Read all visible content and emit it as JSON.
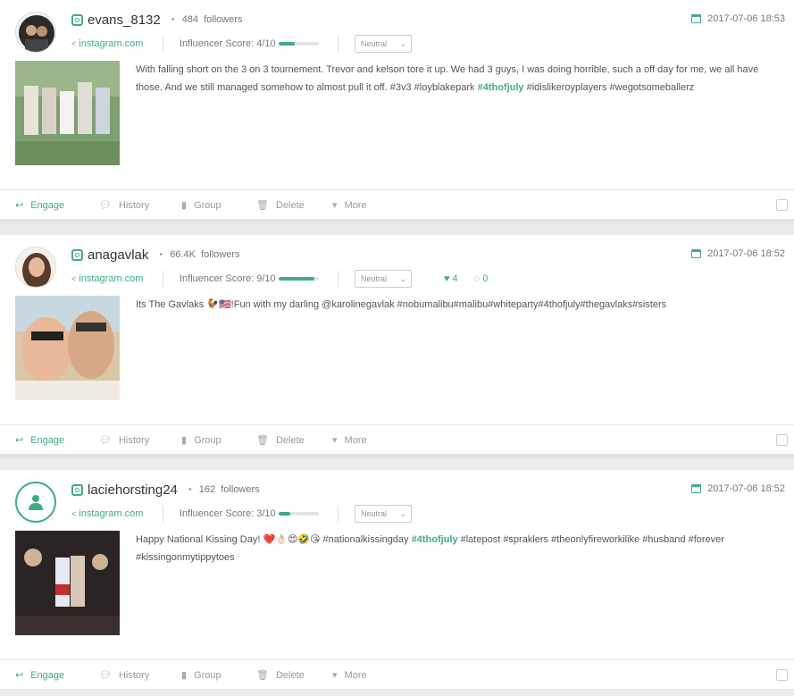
{
  "accent_color": "#3fad83",
  "action_labels": {
    "engage": "Engage",
    "history": "History",
    "group": "Group",
    "delete": "Delete",
    "more": "More"
  },
  "posts": [
    {
      "username": "evans_8132",
      "followers": "484",
      "followers_label": "followers",
      "source": "instagram.com",
      "influencer_label": "Influencer Score:",
      "influencer_score": "4/10",
      "influencer_value": 0.4,
      "sentiment": "Neutral",
      "date": "2017-07-06 18:53",
      "likes": null,
      "comments": null,
      "caption_parts": [
        {
          "text": "With falling short on the 3 on 3 tournement. Trevor and kelson tore it up. We had 3 guys, I was doing horrible, such a off day for me, we all have those. And we still managed somehow to almost pull it off. #3v3 #loyblakepark ",
          "tag": false
        },
        {
          "text": "#4thofjuly",
          "tag": true
        },
        {
          "text": " #idislikeroyplayers #wegotsomeballerz",
          "tag": false
        }
      ],
      "avatar_type": "photo",
      "photo_icon": "group-photo"
    },
    {
      "username": "anagavlak",
      "followers": "66.4K",
      "followers_label": "followers",
      "source": "instagram.com",
      "influencer_label": "Influencer Score:",
      "influencer_score": "9/10",
      "influencer_value": 0.9,
      "sentiment": "Neutral",
      "date": "2017-07-06 18:52",
      "likes": "4",
      "comments": "0",
      "caption_parts": [
        {
          "text": "Its The Gavlaks 🐓🇺🇸!Fun with my darling @karolinegavlak #nobumalibu#malibu#whiteparty#4thofjuly#thegavlaks#sisters",
          "tag": false
        }
      ],
      "avatar_type": "photo",
      "photo_icon": "selfie-photo"
    },
    {
      "username": "laciehorsting24",
      "followers": "162",
      "followers_label": "followers",
      "source": "instagram.com",
      "influencer_label": "Influencer Score:",
      "influencer_score": "3/10",
      "influencer_value": 0.3,
      "sentiment": "Neutral",
      "date": "2017-07-06 18:52",
      "likes": null,
      "comments": null,
      "caption_parts": [
        {
          "text": "Happy National Kissing Day! ❤️👌🏻😍🤣😘 #nationalkissingday ",
          "tag": false
        },
        {
          "text": "#4thofjuly",
          "tag": true
        },
        {
          "text": " #latepost #spraklers #theonlyfireworkilike #husband #forever #kissingonmytippytoes",
          "tag": false
        }
      ],
      "avatar_type": "placeholder",
      "photo_icon": "sparkler-photo"
    }
  ]
}
